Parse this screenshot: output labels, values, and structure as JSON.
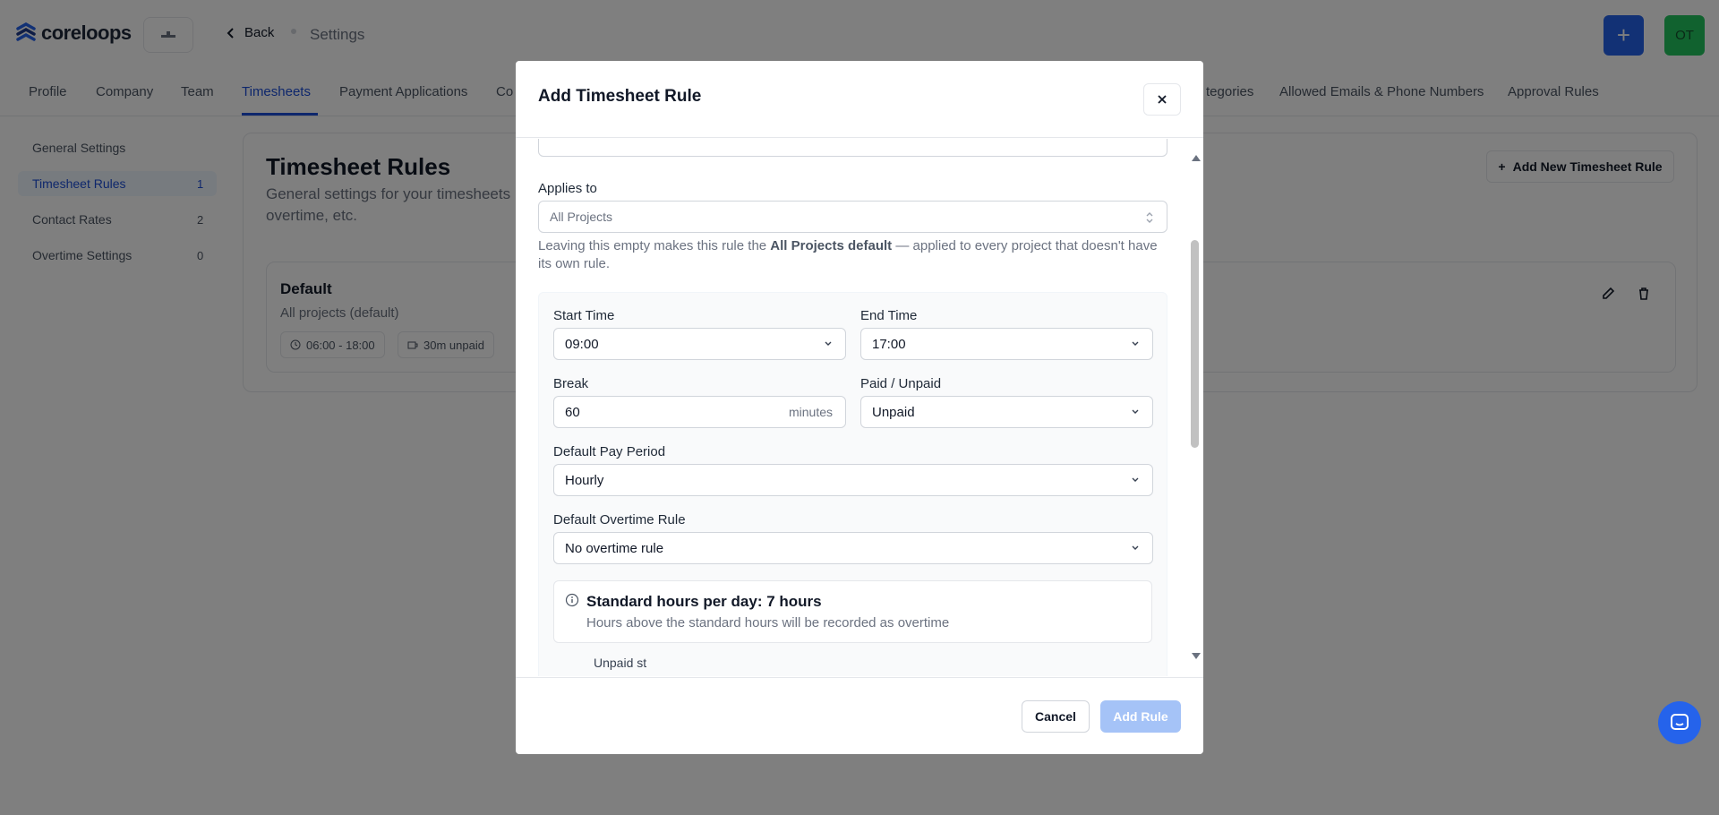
{
  "app": {
    "brand": "coreloops"
  },
  "header": {
    "back_label": "Back",
    "breadcrumb_current": "Settings",
    "avatar_initials": "OT"
  },
  "tabs": [
    {
      "label": "Profile"
    },
    {
      "label": "Company"
    },
    {
      "label": "Team"
    },
    {
      "label": "Timesheets"
    },
    {
      "label": "Payment Applications"
    },
    {
      "label": "Co"
    },
    {
      "label": "tegories"
    },
    {
      "label": "Allowed Emails & Phone Numbers"
    },
    {
      "label": "Approval Rules"
    }
  ],
  "sidebar": {
    "items": [
      {
        "label": "General Settings",
        "count": ""
      },
      {
        "label": "Timesheet Rules",
        "count": "1"
      },
      {
        "label": "Contact Rates",
        "count": "2"
      },
      {
        "label": "Overtime Settings",
        "count": "0"
      }
    ]
  },
  "page": {
    "title": "Timesheet Rules",
    "description": "General settings for your timesheets overtime, etc.",
    "add_button": "Add New Timesheet Rule",
    "rule": {
      "name": "Default",
      "scope": "All projects (default)",
      "chip_hours": "06:00 - 18:00",
      "chip_break": "30m unpaid"
    }
  },
  "modal": {
    "title": "Add Timesheet Rule",
    "applies_to_label": "Applies to",
    "applies_to_placeholder": "All Projects",
    "hint_prefix": "Leaving this empty makes this rule the ",
    "hint_bold": "All Projects default",
    "hint_suffix": " — applied to every project that doesn't have its own rule.",
    "start_time_label": "Start Time",
    "start_time_value": "09:00",
    "end_time_label": "End Time",
    "end_time_value": "17:00",
    "break_label": "Break",
    "break_value": "60",
    "break_suffix": "minutes",
    "paid_label": "Paid / Unpaid",
    "paid_value": "Unpaid",
    "pay_period_label": "Default Pay Period",
    "pay_period_value": "Hourly",
    "overtime_label": "Default Overtime Rule",
    "overtime_value": "No overtime rule",
    "info_title": "Standard hours per day: 7 hours",
    "info_sub": "Hours above the standard hours will be recorded as overtime",
    "cut_text": "Unpaid st",
    "cancel_label": "Cancel",
    "submit_label": "Add Rule"
  },
  "colors": {
    "accent": "#2563eb",
    "primary_disabled": "#a5c3f7",
    "active_tab": "#1d4ed8"
  }
}
